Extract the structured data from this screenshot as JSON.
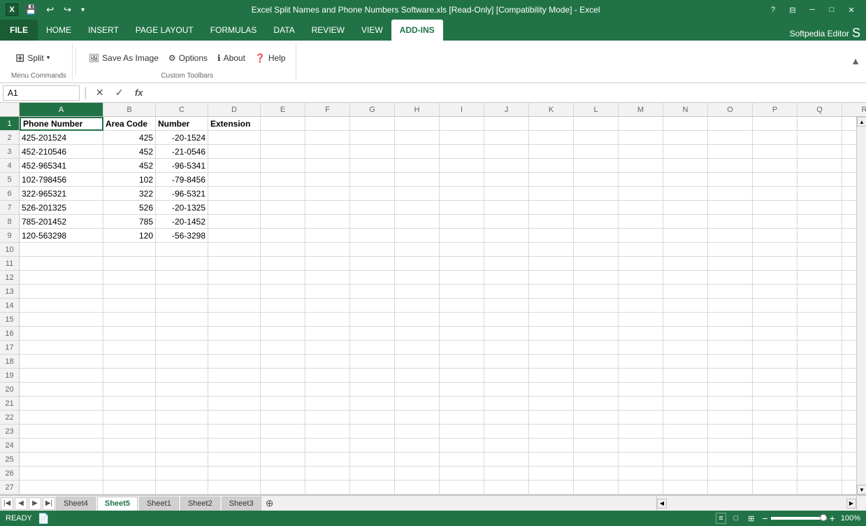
{
  "titleBar": {
    "title": "Excel Split Names and Phone Numbers Software.xls [Read-Only] [Compatibility Mode] - Excel",
    "helpBtn": "?",
    "minBtn": "─",
    "maxBtn": "□",
    "closeBtn": "✕"
  },
  "quickAccess": {
    "saveIcon": "💾",
    "undoIcon": "↩",
    "redoIcon": "↪",
    "moreIcon": "▾"
  },
  "tabs": [
    {
      "label": "FILE",
      "id": "file",
      "active": false,
      "isFile": true
    },
    {
      "label": "HOME",
      "id": "home",
      "active": false
    },
    {
      "label": "INSERT",
      "id": "insert",
      "active": false
    },
    {
      "label": "PAGE LAYOUT",
      "id": "pagelayout",
      "active": false
    },
    {
      "label": "FORMULAS",
      "id": "formulas",
      "active": false
    },
    {
      "label": "DATA",
      "id": "data",
      "active": false
    },
    {
      "label": "REVIEW",
      "id": "review",
      "active": false
    },
    {
      "label": "VIEW",
      "id": "view",
      "active": false
    },
    {
      "label": "ADD-INS",
      "id": "addins",
      "active": true
    }
  ],
  "ribbon": {
    "groups": [
      {
        "id": "split-group",
        "buttons": [
          {
            "label": "Split",
            "icon": "⊞",
            "hasDropdown": true,
            "name": "split-btn"
          }
        ],
        "label": ""
      },
      {
        "id": "custom-toolbar",
        "buttons": [
          {
            "label": "Save As Image",
            "icon": "🖼",
            "name": "save-as-image-btn"
          },
          {
            "label": "Options",
            "icon": "⚙",
            "name": "options-btn"
          },
          {
            "label": "About",
            "icon": "ℹ",
            "name": "about-btn"
          },
          {
            "label": "Help",
            "icon": "❓",
            "name": "help-btn"
          }
        ],
        "label": ""
      }
    ],
    "menuCommandsLabel": "Menu Commands",
    "customToolbarsLabel": "Custom Toolbars"
  },
  "formulaBar": {
    "cellRef": "A1",
    "cancelIcon": "✕",
    "confirmIcon": "✓",
    "fxLabel": "fx",
    "formula": ""
  },
  "grid": {
    "selectedCell": "A1",
    "columns": [
      "A",
      "B",
      "C",
      "D",
      "E",
      "F",
      "G",
      "H",
      "I",
      "J",
      "K",
      "L",
      "M",
      "N",
      "O",
      "P",
      "Q",
      "R"
    ],
    "rows": [
      {
        "num": 1,
        "cells": [
          "Phone Number",
          "Area Code",
          "Number",
          "Extension",
          "",
          "",
          "",
          "",
          "",
          "",
          "",
          "",
          "",
          "",
          "",
          "",
          "",
          ""
        ]
      },
      {
        "num": 2,
        "cells": [
          "425-201524",
          "425",
          "-20-1524",
          "",
          "",
          "",
          "",
          "",
          "",
          "",
          "",
          "",
          "",
          "",
          "",
          "",
          "",
          ""
        ]
      },
      {
        "num": 3,
        "cells": [
          "452-210546",
          "452",
          "-21-0546",
          "",
          "",
          "",
          "",
          "",
          "",
          "",
          "",
          "",
          "",
          "",
          "",
          "",
          "",
          ""
        ]
      },
      {
        "num": 4,
        "cells": [
          "452-965341",
          "452",
          "-96-5341",
          "",
          "",
          "",
          "",
          "",
          "",
          "",
          "",
          "",
          "",
          "",
          "",
          "",
          "",
          ""
        ]
      },
      {
        "num": 5,
        "cells": [
          "102-798456",
          "102",
          "-79-8456",
          "",
          "",
          "",
          "",
          "",
          "",
          "",
          "",
          "",
          "",
          "",
          "",
          "",
          "",
          ""
        ]
      },
      {
        "num": 6,
        "cells": [
          "322-965321",
          "322",
          "-96-5321",
          "",
          "",
          "",
          "",
          "",
          "",
          "",
          "",
          "",
          "",
          "",
          "",
          "",
          "",
          ""
        ]
      },
      {
        "num": 7,
        "cells": [
          "526-201325",
          "526",
          "-20-1325",
          "",
          "",
          "",
          "",
          "",
          "",
          "",
          "",
          "",
          "",
          "",
          "",
          "",
          "",
          ""
        ]
      },
      {
        "num": 8,
        "cells": [
          "785-201452",
          "785",
          "-20-1452",
          "",
          "",
          "",
          "",
          "",
          "",
          "",
          "",
          "",
          "",
          "",
          "",
          "",
          "",
          ""
        ]
      },
      {
        "num": 9,
        "cells": [
          "120-563298",
          "120",
          "-56-3298",
          "",
          "",
          "",
          "",
          "",
          "",
          "",
          "",
          "",
          "",
          "",
          "",
          "",
          "",
          ""
        ]
      },
      {
        "num": 10,
        "cells": [
          "",
          "",
          "",
          "",
          "",
          "",
          "",
          "",
          "",
          "",
          "",
          "",
          "",
          "",
          "",
          "",
          "",
          ""
        ]
      },
      {
        "num": 11,
        "cells": [
          "",
          "",
          "",
          "",
          "",
          "",
          "",
          "",
          "",
          "",
          "",
          "",
          "",
          "",
          "",
          "",
          "",
          ""
        ]
      },
      {
        "num": 12,
        "cells": [
          "",
          "",
          "",
          "",
          "",
          "",
          "",
          "",
          "",
          "",
          "",
          "",
          "",
          "",
          "",
          "",
          "",
          ""
        ]
      },
      {
        "num": 13,
        "cells": [
          "",
          "",
          "",
          "",
          "",
          "",
          "",
          "",
          "",
          "",
          "",
          "",
          "",
          "",
          "",
          "",
          "",
          ""
        ]
      },
      {
        "num": 14,
        "cells": [
          "",
          "",
          "",
          "",
          "",
          "",
          "",
          "",
          "",
          "",
          "",
          "",
          "",
          "",
          "",
          "",
          "",
          ""
        ]
      },
      {
        "num": 15,
        "cells": [
          "",
          "",
          "",
          "",
          "",
          "",
          "",
          "",
          "",
          "",
          "",
          "",
          "",
          "",
          "",
          "",
          "",
          ""
        ]
      },
      {
        "num": 16,
        "cells": [
          "",
          "",
          "",
          "",
          "",
          "",
          "",
          "",
          "",
          "",
          "",
          "",
          "",
          "",
          "",
          "",
          "",
          ""
        ]
      },
      {
        "num": 17,
        "cells": [
          "",
          "",
          "",
          "",
          "",
          "",
          "",
          "",
          "",
          "",
          "",
          "",
          "",
          "",
          "",
          "",
          "",
          ""
        ]
      },
      {
        "num": 18,
        "cells": [
          "",
          "",
          "",
          "",
          "",
          "",
          "",
          "",
          "",
          "",
          "",
          "",
          "",
          "",
          "",
          "",
          "",
          ""
        ]
      },
      {
        "num": 19,
        "cells": [
          "",
          "",
          "",
          "",
          "",
          "",
          "",
          "",
          "",
          "",
          "",
          "",
          "",
          "",
          "",
          "",
          "",
          ""
        ]
      },
      {
        "num": 20,
        "cells": [
          "",
          "",
          "",
          "",
          "",
          "",
          "",
          "",
          "",
          "",
          "",
          "",
          "",
          "",
          "",
          "",
          "",
          ""
        ]
      },
      {
        "num": 21,
        "cells": [
          "",
          "",
          "",
          "",
          "",
          "",
          "",
          "",
          "",
          "",
          "",
          "",
          "",
          "",
          "",
          "",
          "",
          ""
        ]
      },
      {
        "num": 22,
        "cells": [
          "",
          "",
          "",
          "",
          "",
          "",
          "",
          "",
          "",
          "",
          "",
          "",
          "",
          "",
          "",
          "",
          "",
          ""
        ]
      },
      {
        "num": 23,
        "cells": [
          "",
          "",
          "",
          "",
          "",
          "",
          "",
          "",
          "",
          "",
          "",
          "",
          "",
          "",
          "",
          "",
          "",
          ""
        ]
      },
      {
        "num": 24,
        "cells": [
          "",
          "",
          "",
          "",
          "",
          "",
          "",
          "",
          "",
          "",
          "",
          "",
          "",
          "",
          "",
          "",
          "",
          ""
        ]
      },
      {
        "num": 25,
        "cells": [
          "",
          "",
          "",
          "",
          "",
          "",
          "",
          "",
          "",
          "",
          "",
          "",
          "",
          "",
          "",
          "",
          "",
          ""
        ]
      },
      {
        "num": 26,
        "cells": [
          "",
          "",
          "",
          "",
          "",
          "",
          "",
          "",
          "",
          "",
          "",
          "",
          "",
          "",
          "",
          "",
          "",
          ""
        ]
      },
      {
        "num": 27,
        "cells": [
          "",
          "",
          "",
          "",
          "",
          "",
          "",
          "",
          "",
          "",
          "",
          "",
          "",
          "",
          "",
          "",
          "",
          ""
        ]
      }
    ]
  },
  "sheetTabs": {
    "tabs": [
      "Sheet4",
      "Sheet5",
      "Sheet1",
      "Sheet2",
      "Sheet3"
    ],
    "active": "Sheet5",
    "addLabel": "+"
  },
  "statusBar": {
    "status": "READY",
    "pageViewIcon": "⊞",
    "normalViewIcon": "≡",
    "layoutViewIcon": "□",
    "zoomOutIcon": "−",
    "zoomInIcon": "+",
    "zoomLevel": "100%"
  },
  "userLabel": "Softpedia Editor"
}
